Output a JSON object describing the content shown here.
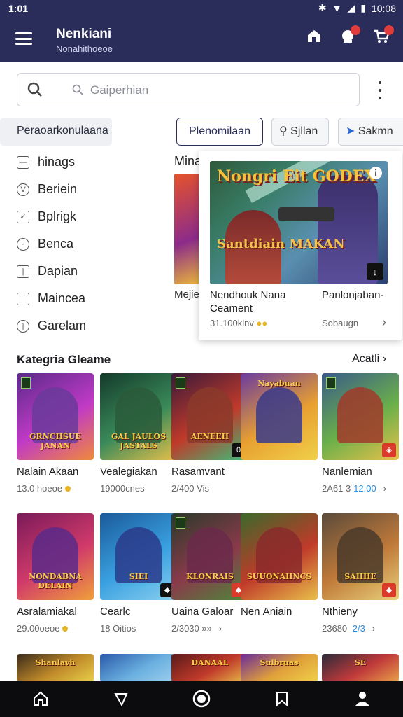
{
  "status": {
    "time": "1:01",
    "clock": "10:08"
  },
  "app": {
    "title": "Nenkiani",
    "subtitle": "Nonahithoeoe"
  },
  "search": {
    "placeholder": "Gaiperhian"
  },
  "chips": {
    "category": "Peraoarkonulaana",
    "a": "Plenomilaan",
    "b": "Sjllan",
    "c": "Sakmn"
  },
  "sidebar": {
    "items": [
      {
        "label": "hinags",
        "icon": "checkbox-icon"
      },
      {
        "label": "Beriein",
        "icon": "clock-icon"
      },
      {
        "label": "Bplrigk",
        "icon": "check-icon"
      },
      {
        "label": "Benca",
        "icon": "dot-circle-icon"
      },
      {
        "label": "Dapian",
        "icon": "bracket-icon"
      },
      {
        "label": "Maincea",
        "icon": "bracket-icon"
      },
      {
        "label": "Garelam",
        "icon": "bracket-icon"
      }
    ]
  },
  "mid": {
    "label": "Mina",
    "caption": "Mejie"
  },
  "popup": {
    "logo_top": "Nongri Eit GODEX",
    "logo_bottom": "Santdiain MAKAN",
    "title": "Nendhouk Nana Ceament",
    "price": "31.100kinv",
    "title2": "Panlonjaban-",
    "price2": "Sobaugn"
  },
  "section": {
    "title": "Kategria Gleame",
    "link": "Acatli"
  },
  "games_row1": [
    {
      "name": "Nalain Akaan",
      "meta": "13.0 hoeoe",
      "plate": "GRNCHSUE JANAN",
      "colors": [
        "#5a2a8a",
        "#c03ac6",
        "#f08a3a"
      ],
      "fig": "#6a3a9a",
      "corner": "",
      "tag": true,
      "coin": true
    },
    {
      "name": "Vealegiakan",
      "meta": "19000cnes",
      "plate": "GAL JAULOS JASTALS",
      "colors": [
        "#143a2a",
        "#3a8a5a",
        "#e8c04a"
      ],
      "fig": "#2a5a3a",
      "corner": "",
      "tag": false,
      "coin": false
    },
    {
      "name": "Rasamvant",
      "meta": "2/400 Vis",
      "plate": "AENEEH",
      "colors": [
        "#3a1a3a",
        "#c03a2a",
        "#3ac07a"
      ],
      "fig": "#8a3a2a",
      "corner": "0",
      "tag": true,
      "coin": false
    },
    {
      "name": "Nanlemian",
      "meta": "2A61 3",
      "hl": "12.00",
      "plate": "",
      "colors": [
        "#3a5a8a",
        "#6ab04a",
        "#e8c04a"
      ],
      "fig": "#a03a2a",
      "corner": "◈",
      "cornerRed": true,
      "tag": true,
      "chev": true
    }
  ],
  "games_row1_pop": {
    "name": "",
    "meta": "",
    "plate": "Nayabuan",
    "colors": [
      "#6a3aa0",
      "#e8a030",
      "#f0d04a"
    ],
    "fig": "#3a3a8a"
  },
  "games_row2": [
    {
      "name": "Asralamiakal",
      "meta": "29.00oeoe",
      "plate": "NONDABNA DELAIN",
      "colors": [
        "#7a1a5a",
        "#d03a6a",
        "#f0a03a"
      ],
      "fig": "#5a2a8a",
      "corner": "",
      "tag": false,
      "coin": true
    },
    {
      "name": "Cearlc",
      "meta": "18 Oitios",
      "plate": "SIEI",
      "colors": [
        "#1a5a9a",
        "#3aa0e0",
        "#8ad0f0"
      ],
      "fig": "#2a3a8a",
      "corner": "◆",
      "cornerRed": false,
      "tag": false
    },
    {
      "name": "Uaina Galoar",
      "meta": "2/3030 »»",
      "plate": "KLONRAIS",
      "colors": [
        "#2a3a2a",
        "#8a3a4a",
        "#4a8a3a"
      ],
      "fig": "#6a2a4a",
      "corner": "◆",
      "cornerRed": true,
      "tag": true,
      "chev": true
    },
    {
      "name": "Nen Aniain",
      "meta": "",
      "plate": "SUUONAIINCS",
      "colors": [
        "#3a6a2a",
        "#c03a2a",
        "#e8c04a"
      ],
      "fig": "#8a2a2a",
      "corner": "",
      "tag": false
    },
    {
      "name": "Nthieny",
      "meta": "23680 ",
      "hl": "2/3",
      "plate": "SAIIHE",
      "colors": [
        "#5a4a3a",
        "#c07a3a",
        "#e8d07a"
      ],
      "fig": "#4a3a2a",
      "corner": "◆",
      "cornerRed": true,
      "tag": false,
      "chev": true
    }
  ],
  "games_row3": [
    {
      "plate": "Shanlavh",
      "colors": [
        "#3a2a1a",
        "#c08a2a",
        "#e8d04a"
      ]
    },
    {
      "plate": "",
      "colors": [
        "#2a5aaa",
        "#6ab0e0",
        "#a0d0f0"
      ]
    },
    {
      "plate": "DANAAL",
      "colors": [
        "#5a1a1a",
        "#c03a2a",
        "#e8c04a"
      ]
    },
    {
      "plate": "Sulbruas",
      "colors": [
        "#6a2a9a",
        "#e0a03a",
        "#f0d04a"
      ]
    },
    {
      "plate": "SE",
      "colors": [
        "#2a2a3a",
        "#c03a3a",
        "#e8a04a"
      ]
    }
  ],
  "nav": {
    "items": [
      "home-icon",
      "back-icon",
      "circle-icon",
      "bookmark-icon",
      "profile-icon"
    ]
  }
}
